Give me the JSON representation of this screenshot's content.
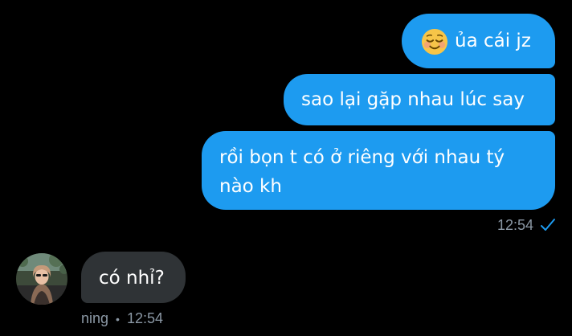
{
  "conversation": {
    "outgoing": [
      {
        "emoji": "smiling-face-icon",
        "text": "ủa cái jz"
      },
      {
        "text": "sao lại gặp nhau lúc say"
      },
      {
        "text": "rồi bọn t có ở riêng với nhau tý nào kh"
      }
    ],
    "outgoing_meta": {
      "time": "12:54",
      "status_icon": "sent-check-icon"
    },
    "incoming": {
      "text": "có nhỉ?",
      "sender": "ning",
      "separator": "•",
      "time": "12:54",
      "avatar_icon": "user-avatar-photo"
    }
  },
  "colors": {
    "background": "#000000",
    "outgoing_bubble": "#1d9bf0",
    "incoming_bubble": "#2f3336",
    "meta_text": "#8b98a5",
    "check": "#1d9bf0"
  }
}
